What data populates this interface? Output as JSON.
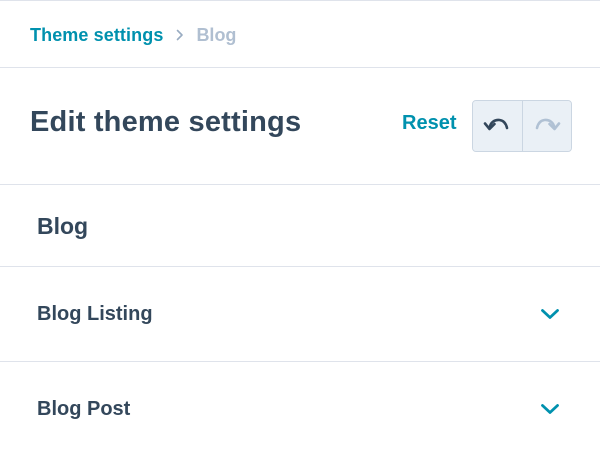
{
  "breadcrumb": {
    "parent": "Theme settings",
    "current": "Blog",
    "separator_icon": "chevron-right-icon"
  },
  "header": {
    "title": "Edit theme settings",
    "reset_label": "Reset",
    "undo_icon": "undo-icon",
    "redo_icon": "redo-icon",
    "undo_enabled": true,
    "redo_enabled": false
  },
  "section": {
    "heading": "Blog",
    "items": [
      {
        "label": "Blog Listing",
        "icon": "chevron-down-icon",
        "expanded": false
      },
      {
        "label": "Blog Post",
        "icon": "chevron-down-icon",
        "expanded": false
      }
    ]
  },
  "colors": {
    "link": "#0091ae",
    "text": "#33475b",
    "muted": "#b0bfd1",
    "divider": "#dfe3eb",
    "button_bg": "#eaf0f6"
  }
}
